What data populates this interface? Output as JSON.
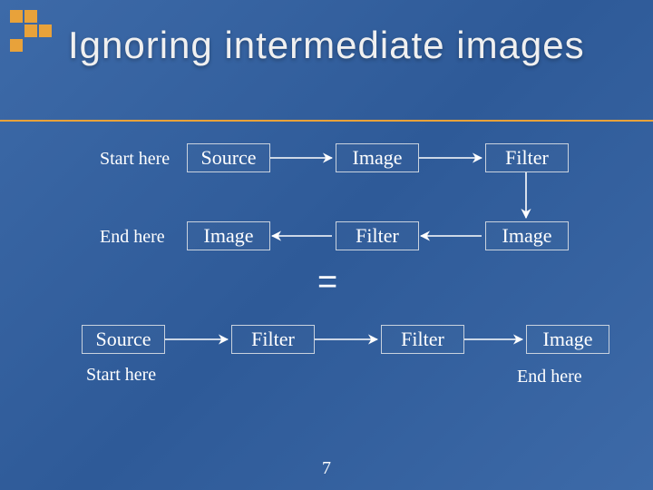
{
  "slide": {
    "title": "Ignoring intermediate images",
    "page_number": "7",
    "equals_sign": "="
  },
  "top_flow": {
    "start_label": "Start here",
    "end_label": "End here",
    "nodes": [
      "Source",
      "Image",
      "Filter",
      "Image",
      "Filter",
      "Image"
    ]
  },
  "bottom_flow": {
    "start_label": "Start here",
    "end_label": "End here",
    "nodes": [
      "Source",
      "Filter",
      "Filter",
      "Image"
    ]
  },
  "colors": {
    "accent": "#e8a23a",
    "background": "#2e5a98",
    "box_border": "#c9d2de"
  }
}
